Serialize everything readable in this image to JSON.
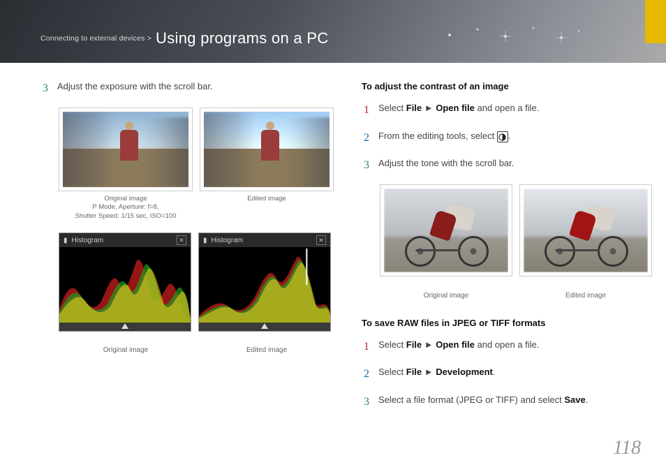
{
  "header": {
    "breadcrumb_prefix": "Connecting to external devices >",
    "title": "Using programs on a PC"
  },
  "left": {
    "step3": "Adjust the exposure with the scroll bar.",
    "photo": {
      "original_caption_line1": "Original image",
      "original_caption_line2": "P Mode, Aperture: f=8,",
      "original_caption_line3": "Shutter Speed: 1/15 sec, ISO=100",
      "edited_caption": "Edited image"
    },
    "histogram": {
      "label": "Histogram",
      "original_caption": "Original image",
      "edited_caption": "Edited image"
    }
  },
  "right": {
    "contrast": {
      "heading": "To adjust the contrast of an image",
      "s1_pre": "Select ",
      "s1_b1": "File",
      "s1_arrow": " ► ",
      "s1_b2": "Open file",
      "s1_post": " and open a file.",
      "s2_pre": "From the editing tools, select ",
      "s2_post": ".",
      "s3": "Adjust the tone with the scroll bar.",
      "original_caption": "Original image",
      "edited_caption": "Edited image"
    },
    "save": {
      "heading": "To save RAW files in JPEG or TIFF formats",
      "s1_pre": "Select ",
      "s1_b1": "File",
      "s1_arrow": " ► ",
      "s1_b2": "Open file",
      "s1_post": " and open a file.",
      "s2_pre": "Select ",
      "s2_b1": "File",
      "s2_arrow": " ► ",
      "s2_b2": "Development",
      "s2_post": ".",
      "s3_pre": "Select a file format (JPEG or TIFF) and select ",
      "s3_b": "Save",
      "s3_post": "."
    }
  },
  "page_number": "118",
  "nums": {
    "n1": "1",
    "n2": "2",
    "n3": "3"
  }
}
